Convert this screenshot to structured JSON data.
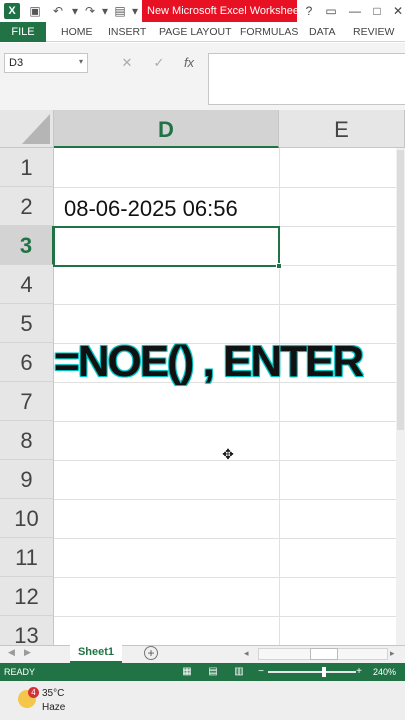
{
  "title_bar": {
    "logo": "X",
    "doc_title": "New Microsoft Excel Workshee...",
    "help": "?",
    "minimize": "—",
    "restore": "□",
    "close": "✕"
  },
  "ribbon": {
    "tabs": [
      "FILE",
      "HOME",
      "INSERT",
      "PAGE LAYOUT",
      "FORMULAS",
      "DATA",
      "REVIEW"
    ]
  },
  "formula_bar": {
    "name_box": "D3",
    "name_box_arrow": "▾",
    "cancel": "✕",
    "enter": "✓",
    "fx": "fx",
    "value": ""
  },
  "grid": {
    "columns": [
      "D",
      "E"
    ],
    "rows": [
      "1",
      "2",
      "3",
      "4",
      "5",
      "6",
      "7",
      "8",
      "9",
      "10",
      "11",
      "12",
      "13"
    ],
    "active_row": "3",
    "cells": {
      "D2": "08-06-2025 06:56"
    },
    "overlay_text": "=NOE() , ENTER"
  },
  "sheet_tabs": {
    "tabs": [
      "Sheet1"
    ],
    "add": "+"
  },
  "status_bar": {
    "ready": "READY",
    "zoom_minus": "−",
    "zoom_plus": "+",
    "zoom_level": "240%"
  },
  "taskbar": {
    "badge": "4",
    "temperature": "35°C",
    "condition": "Haze"
  },
  "colors": {
    "excel_green": "#217346",
    "title_red": "#e81123"
  }
}
